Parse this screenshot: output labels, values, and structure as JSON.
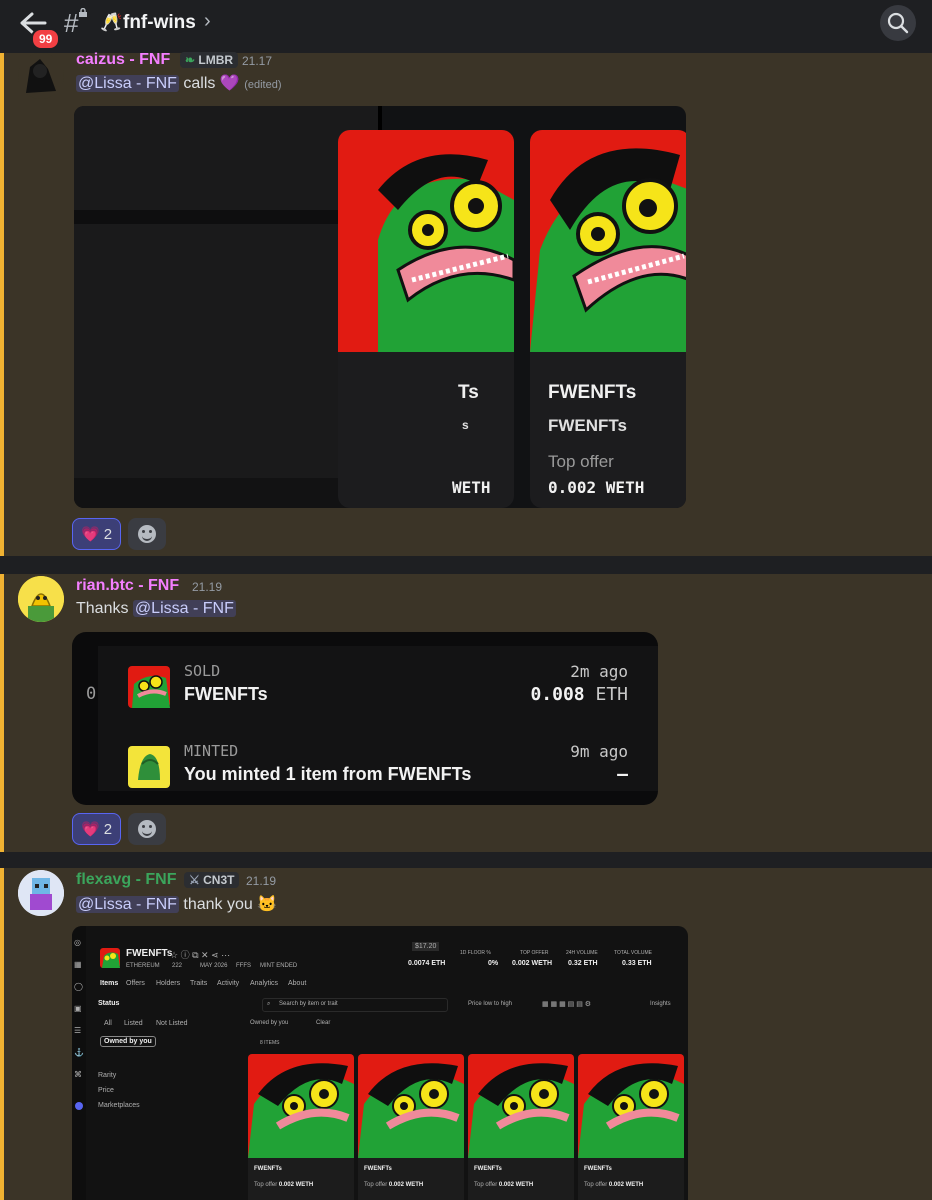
{
  "header": {
    "back_icon": "back-arrow-icon",
    "unread_badge": "99",
    "channel_emoji": "🥂",
    "channel_name": "fnf-wins",
    "search_icon": "search-icon"
  },
  "messages": [
    {
      "username": "caizus - FNF",
      "username_color": "#f47fff",
      "tag": "LMBR",
      "tag_icon": "leaf-icon",
      "time": "21.17",
      "mention": "@Lissa - FNF",
      "text": "calls",
      "emoji": "💜",
      "edited": "(edited)",
      "cards": [
        {
          "name": "FWENFTs",
          "collection": "FWENFTs",
          "offer_label": "Top offer",
          "offer_value": "0.002 WETH"
        },
        {
          "name": "FWENFTs",
          "collection": "FWENFTs",
          "offer_label": "Top offer",
          "offer_value": "0.002 WETH"
        }
      ],
      "cropped_card": {
        "name_tail": "Ts",
        "sub_tail": "s",
        "value_tail": "WETH"
      },
      "reactions": [
        {
          "emoji": "💗",
          "count": "2"
        }
      ]
    },
    {
      "username": "rian.btc - FNF",
      "username_color": "#f47fff",
      "time": "21.19",
      "prefix": "Thanks",
      "mention": "@Lissa - FNF",
      "activity": [
        {
          "label": "SOLD",
          "title": "FWENFTs",
          "ago": "2m ago",
          "amount": "0.008",
          "unit": "ETH"
        },
        {
          "label": "MINTED",
          "title": "You minted 1 item from FWENFTs",
          "ago": "9m ago",
          "amount": "–",
          "unit": ""
        }
      ],
      "left_digit": "0",
      "reactions": [
        {
          "emoji": "💗",
          "count": "2"
        }
      ]
    },
    {
      "username": "flexavg - FNF",
      "username_color": "#3ba55c",
      "tag": "CN3T",
      "tag_icon": "sword-icon",
      "time": "21.19",
      "mention": "@Lissa - FNF",
      "text": "thank you",
      "emoji": "🐱",
      "opensea": {
        "collection": "FWENFTs",
        "chain": "ETHEREUM",
        "items": "222",
        "date": "MAY 2026",
        "ticker": "FFFS",
        "status": "MINT ENDED",
        "price_label": "$17.20",
        "stats": [
          {
            "label": "1D FLOOR %",
            "value": "0.0074 ETH"
          },
          {
            "label": "",
            "value": "0%"
          },
          {
            "label": "TOP OFFER",
            "value": "0.002 WETH"
          },
          {
            "label": "24H VOLUME",
            "value": "0.32 ETH"
          },
          {
            "label": "TOTAL VOLUME",
            "value": "0.33 ETH"
          }
        ],
        "tabs": [
          "Items",
          "Offers",
          "Holders",
          "Traits",
          "Activity",
          "Analytics",
          "About"
        ],
        "status_heading": "Status",
        "status_filters": [
          "All",
          "Listed",
          "Not Listed"
        ],
        "owned_chip": "Owned by you",
        "filters": [
          "Rarity",
          "Price",
          "Marketplaces"
        ],
        "search_placeholder": "Search by item or trait",
        "sort": "Price low to high",
        "insights": "Insights",
        "active_filter": "Owned by you",
        "clear": "Clear",
        "item_count": "8 ITEMS",
        "cards": [
          {
            "name": "FWENFTs",
            "offer_label": "Top offer",
            "offer_value": "0.002 WETH"
          },
          {
            "name": "FWENFTs",
            "offer_label": "Top offer",
            "offer_value": "0.002 WETH"
          },
          {
            "name": "FWENFTs",
            "offer_label": "Top offer",
            "offer_value": "0.002 WETH"
          },
          {
            "name": "FWENFTs",
            "offer_label": "Top offer",
            "offer_value": "0.002 WETH"
          }
        ]
      }
    }
  ]
}
